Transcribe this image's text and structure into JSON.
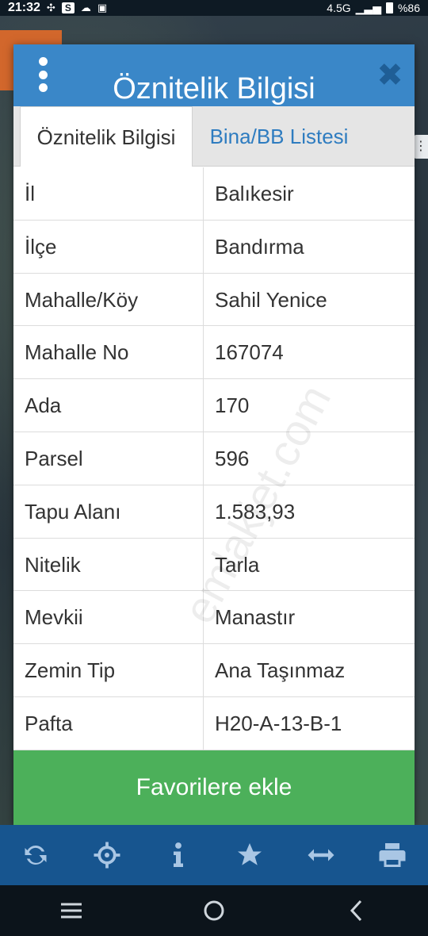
{
  "status_bar": {
    "time": "21:32",
    "network": "4.5G",
    "battery": "%86"
  },
  "dialog": {
    "title": "Öznitelik Bilgisi",
    "tabs": [
      {
        "label": "Öznitelik Bilgisi",
        "active": true
      },
      {
        "label": "Bina/BB Listesi",
        "active": false
      }
    ],
    "rows": [
      {
        "key": "İl",
        "value": "Balıkesir"
      },
      {
        "key": "İlçe",
        "value": "Bandırma"
      },
      {
        "key": "Mahalle/Köy",
        "value": "Sahil Yenice"
      },
      {
        "key": "Mahalle No",
        "value": "167074"
      },
      {
        "key": "Ada",
        "value": "170"
      },
      {
        "key": "Parsel",
        "value": "596"
      },
      {
        "key": "Tapu Alanı",
        "value": "1.583,93"
      },
      {
        "key": "Nitelik",
        "value": "Tarla"
      },
      {
        "key": "Mevkii",
        "value": "Manastır"
      },
      {
        "key": "Zemin Tip",
        "value": "Ana Taşınmaz"
      },
      {
        "key": "Pafta",
        "value": "H20-A-13-B-1"
      }
    ],
    "favorite_button": "Favorilere ekle"
  },
  "watermark": "emlakjet.com",
  "toolbar": {
    "icons": [
      "refresh-icon",
      "locate-icon",
      "info-icon",
      "star-icon",
      "measure-icon",
      "print-icon"
    ]
  },
  "colors": {
    "header": "#3a87c8",
    "toolbar": "#17558f",
    "favorite_button": "#4cb05a",
    "tab_link": "#2e7cc0"
  }
}
